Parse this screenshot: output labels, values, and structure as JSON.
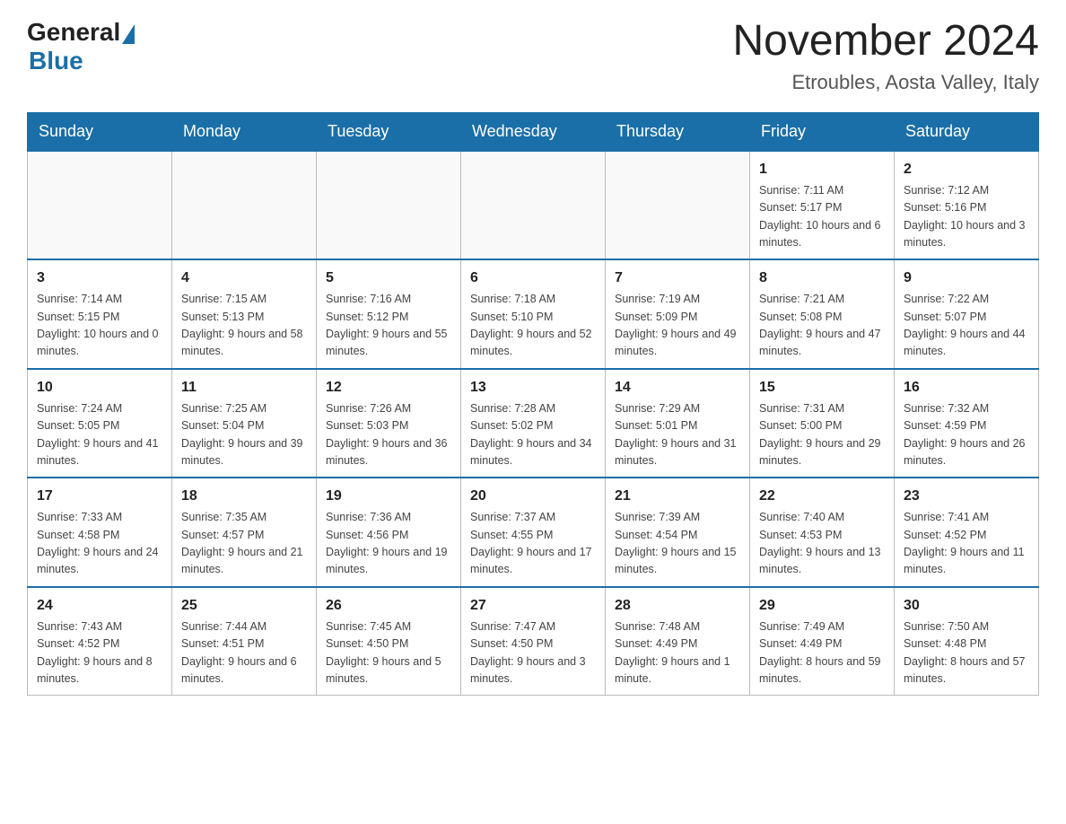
{
  "header": {
    "logo_general": "General",
    "logo_blue": "Blue",
    "month_year": "November 2024",
    "location": "Etroubles, Aosta Valley, Italy"
  },
  "days_of_week": [
    "Sunday",
    "Monday",
    "Tuesday",
    "Wednesday",
    "Thursday",
    "Friday",
    "Saturday"
  ],
  "weeks": [
    [
      {
        "day": "",
        "info": ""
      },
      {
        "day": "",
        "info": ""
      },
      {
        "day": "",
        "info": ""
      },
      {
        "day": "",
        "info": ""
      },
      {
        "day": "",
        "info": ""
      },
      {
        "day": "1",
        "info": "Sunrise: 7:11 AM\nSunset: 5:17 PM\nDaylight: 10 hours and 6 minutes."
      },
      {
        "day": "2",
        "info": "Sunrise: 7:12 AM\nSunset: 5:16 PM\nDaylight: 10 hours and 3 minutes."
      }
    ],
    [
      {
        "day": "3",
        "info": "Sunrise: 7:14 AM\nSunset: 5:15 PM\nDaylight: 10 hours and 0 minutes."
      },
      {
        "day": "4",
        "info": "Sunrise: 7:15 AM\nSunset: 5:13 PM\nDaylight: 9 hours and 58 minutes."
      },
      {
        "day": "5",
        "info": "Sunrise: 7:16 AM\nSunset: 5:12 PM\nDaylight: 9 hours and 55 minutes."
      },
      {
        "day": "6",
        "info": "Sunrise: 7:18 AM\nSunset: 5:10 PM\nDaylight: 9 hours and 52 minutes."
      },
      {
        "day": "7",
        "info": "Sunrise: 7:19 AM\nSunset: 5:09 PM\nDaylight: 9 hours and 49 minutes."
      },
      {
        "day": "8",
        "info": "Sunrise: 7:21 AM\nSunset: 5:08 PM\nDaylight: 9 hours and 47 minutes."
      },
      {
        "day": "9",
        "info": "Sunrise: 7:22 AM\nSunset: 5:07 PM\nDaylight: 9 hours and 44 minutes."
      }
    ],
    [
      {
        "day": "10",
        "info": "Sunrise: 7:24 AM\nSunset: 5:05 PM\nDaylight: 9 hours and 41 minutes."
      },
      {
        "day": "11",
        "info": "Sunrise: 7:25 AM\nSunset: 5:04 PM\nDaylight: 9 hours and 39 minutes."
      },
      {
        "day": "12",
        "info": "Sunrise: 7:26 AM\nSunset: 5:03 PM\nDaylight: 9 hours and 36 minutes."
      },
      {
        "day": "13",
        "info": "Sunrise: 7:28 AM\nSunset: 5:02 PM\nDaylight: 9 hours and 34 minutes."
      },
      {
        "day": "14",
        "info": "Sunrise: 7:29 AM\nSunset: 5:01 PM\nDaylight: 9 hours and 31 minutes."
      },
      {
        "day": "15",
        "info": "Sunrise: 7:31 AM\nSunset: 5:00 PM\nDaylight: 9 hours and 29 minutes."
      },
      {
        "day": "16",
        "info": "Sunrise: 7:32 AM\nSunset: 4:59 PM\nDaylight: 9 hours and 26 minutes."
      }
    ],
    [
      {
        "day": "17",
        "info": "Sunrise: 7:33 AM\nSunset: 4:58 PM\nDaylight: 9 hours and 24 minutes."
      },
      {
        "day": "18",
        "info": "Sunrise: 7:35 AM\nSunset: 4:57 PM\nDaylight: 9 hours and 21 minutes."
      },
      {
        "day": "19",
        "info": "Sunrise: 7:36 AM\nSunset: 4:56 PM\nDaylight: 9 hours and 19 minutes."
      },
      {
        "day": "20",
        "info": "Sunrise: 7:37 AM\nSunset: 4:55 PM\nDaylight: 9 hours and 17 minutes."
      },
      {
        "day": "21",
        "info": "Sunrise: 7:39 AM\nSunset: 4:54 PM\nDaylight: 9 hours and 15 minutes."
      },
      {
        "day": "22",
        "info": "Sunrise: 7:40 AM\nSunset: 4:53 PM\nDaylight: 9 hours and 13 minutes."
      },
      {
        "day": "23",
        "info": "Sunrise: 7:41 AM\nSunset: 4:52 PM\nDaylight: 9 hours and 11 minutes."
      }
    ],
    [
      {
        "day": "24",
        "info": "Sunrise: 7:43 AM\nSunset: 4:52 PM\nDaylight: 9 hours and 8 minutes."
      },
      {
        "day": "25",
        "info": "Sunrise: 7:44 AM\nSunset: 4:51 PM\nDaylight: 9 hours and 6 minutes."
      },
      {
        "day": "26",
        "info": "Sunrise: 7:45 AM\nSunset: 4:50 PM\nDaylight: 9 hours and 5 minutes."
      },
      {
        "day": "27",
        "info": "Sunrise: 7:47 AM\nSunset: 4:50 PM\nDaylight: 9 hours and 3 minutes."
      },
      {
        "day": "28",
        "info": "Sunrise: 7:48 AM\nSunset: 4:49 PM\nDaylight: 9 hours and 1 minute."
      },
      {
        "day": "29",
        "info": "Sunrise: 7:49 AM\nSunset: 4:49 PM\nDaylight: 8 hours and 59 minutes."
      },
      {
        "day": "30",
        "info": "Sunrise: 7:50 AM\nSunset: 4:48 PM\nDaylight: 8 hours and 57 minutes."
      }
    ]
  ]
}
